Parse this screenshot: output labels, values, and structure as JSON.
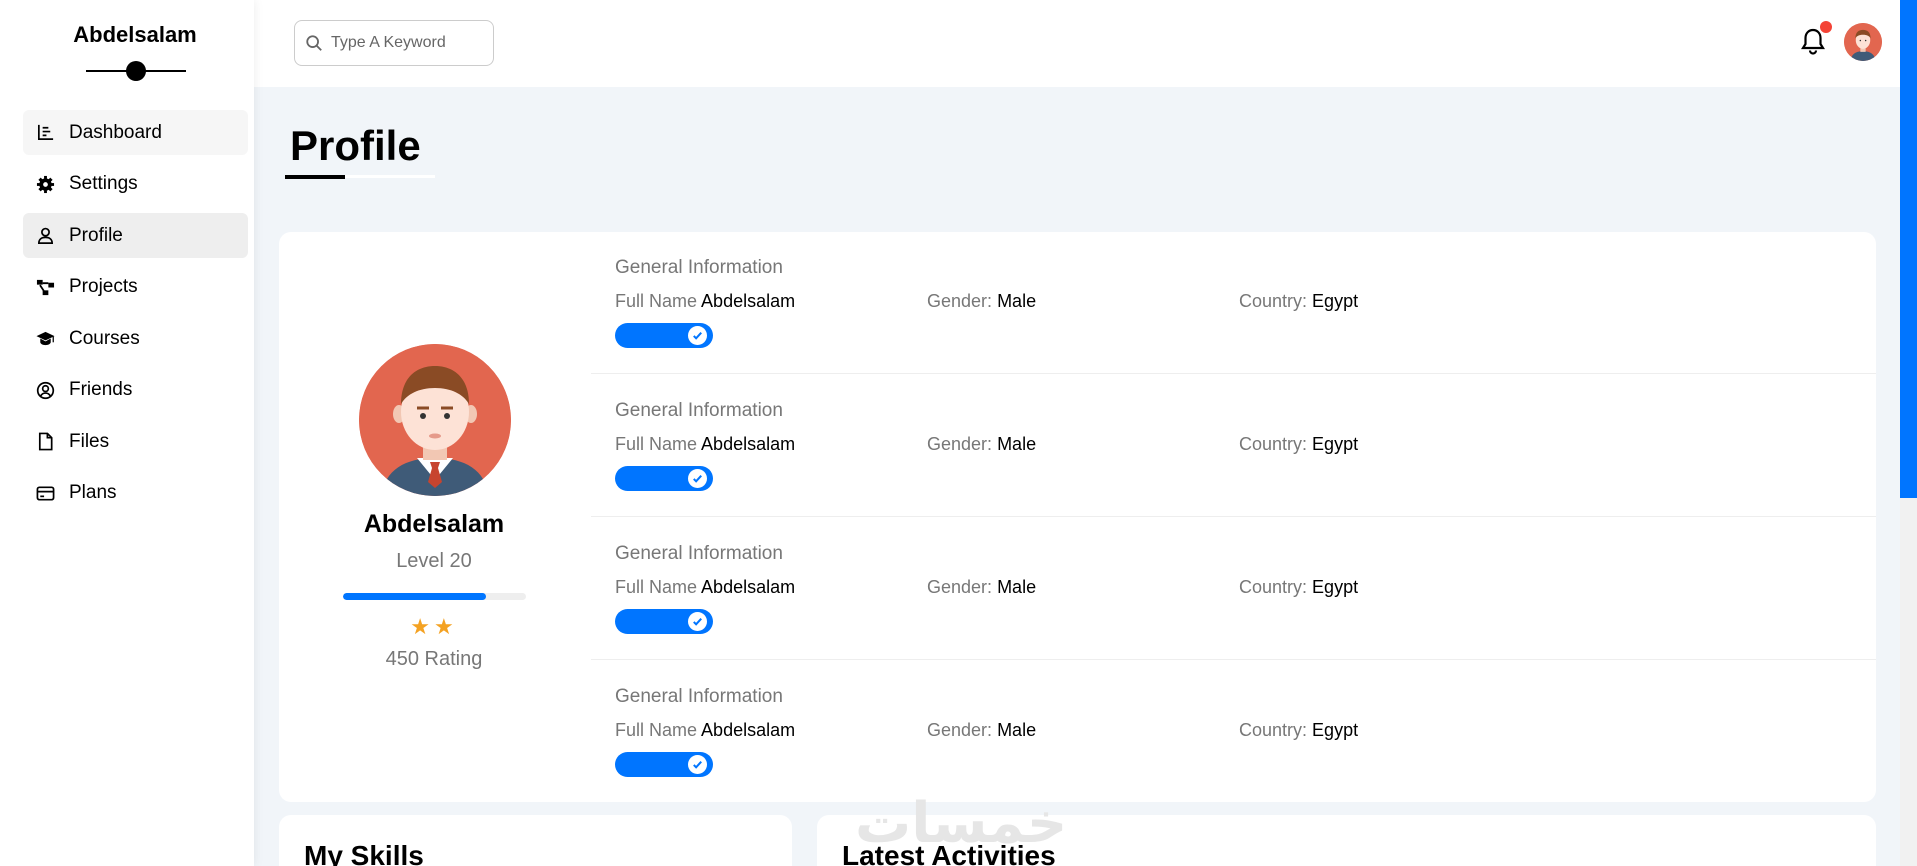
{
  "sidebar": {
    "brand": "Abdelsalam",
    "items": [
      {
        "label": "Dashboard",
        "icon": "chart-icon"
      },
      {
        "label": "Settings",
        "icon": "gear-icon"
      },
      {
        "label": "Profile",
        "icon": "user-icon"
      },
      {
        "label": "Projects",
        "icon": "diagram-icon"
      },
      {
        "label": "Courses",
        "icon": "graduation-cap-icon"
      },
      {
        "label": "Friends",
        "icon": "user-circle-icon"
      },
      {
        "label": "Files",
        "icon": "file-icon"
      },
      {
        "label": "Plans",
        "icon": "credit-card-icon"
      }
    ]
  },
  "header": {
    "search_placeholder": "Type A Keyword"
  },
  "page": {
    "title": "Profile"
  },
  "profile": {
    "name": "Abdelsalam",
    "level": "Level 20",
    "level_progress_percent": 78,
    "stars": "★★",
    "rating": "450 Rating"
  },
  "info_rows": [
    {
      "heading": "General Information",
      "name_label": "Full Name",
      "name_value": "Abdelsalam",
      "gender_label": "Gender:",
      "gender_value": "Male",
      "country_label": "Country:",
      "country_value": "Egypt",
      "toggle_on": true
    },
    {
      "heading": "General Information",
      "name_label": "Full Name",
      "name_value": "Abdelsalam",
      "gender_label": "Gender:",
      "gender_value": "Male",
      "country_label": "Country:",
      "country_value": "Egypt",
      "toggle_on": true
    },
    {
      "heading": "General Information",
      "name_label": "Full Name",
      "name_value": "Abdelsalam",
      "gender_label": "Gender:",
      "gender_value": "Male",
      "country_label": "Country:",
      "country_value": "Egypt",
      "toggle_on": true
    },
    {
      "heading": "General Information",
      "name_label": "Full Name",
      "name_value": "Abdelsalam",
      "gender_label": "Gender:",
      "gender_value": "Male",
      "country_label": "Country:",
      "country_value": "Egypt",
      "toggle_on": true
    }
  ],
  "sections": {
    "skills_title": "My Skills",
    "activities_title": "Latest Activities"
  },
  "watermark": "خمسات",
  "colors": {
    "accent": "#0075ff",
    "avatar_bg": "#e2664f",
    "notification": "#f44336",
    "star": "#f4a223"
  }
}
